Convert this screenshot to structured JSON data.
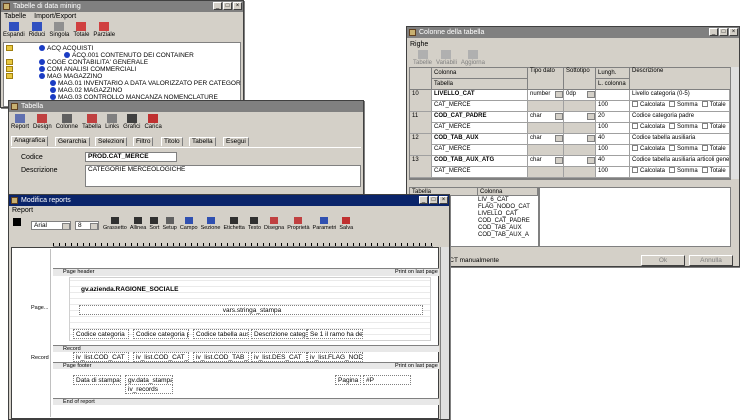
{
  "win1": {
    "title": "Tabelle di data mining",
    "menu": [
      "Tabelle",
      "Import/Export"
    ],
    "toolbar": [
      "Espandi",
      "Riduci",
      "Singola",
      "Totale",
      "Parziale"
    ],
    "tree": [
      "ACQ  ACQUISTI",
      "ACQ.001  CONTENUTO DEI CONTAINER",
      "COGE  CONTABILITA' GENERALE",
      "COM  ANALISI COMMERCIALI",
      "MAG  MAGAZZINO",
      "MAG.01  INVENTARIO A DATA VALORIZZATO PER CATEGOR",
      "MAG.02  MAGAZZINO",
      "MAG.03  CONTROLLO MANCANZA NOMENCLATURE"
    ]
  },
  "win2": {
    "title": "Tabella",
    "toolbar": [
      "Report",
      "Design",
      "Colonne",
      "Tabella",
      "Links",
      "Grafici",
      "Carica"
    ],
    "tabs": [
      "Anagrafica",
      "Gerarchia",
      "Selezioni",
      "Filtro",
      "Titolo",
      "Tabella",
      "Esegui"
    ],
    "codice_label": "Codice",
    "codice_value": "PROD.CAT_MERCE",
    "descrizione_label": "Descrizione",
    "descrizione_value": "CATEGORIE MERCEOLOGICHE"
  },
  "win3": {
    "title": "Colonne della tabella",
    "menu": [
      "Righe"
    ],
    "toolbar": [
      "Tabelle",
      "Variabili",
      "Aggiorna"
    ],
    "headers": [
      "Colonna",
      "Tabella",
      "Tipo dato",
      "Sottotipo",
      "Lungh.",
      "L. colonna",
      "Descrizione"
    ],
    "rows": [
      {
        "n": "10",
        "col": "LIVELLO_CAT",
        "tab": "CAT_MERCE",
        "tipo": "number",
        "sotto": "0dp",
        "lung": "",
        "lcol": "100",
        "desc": "Livello categoria (0-5)"
      },
      {
        "n": "11",
        "col": "COD_CAT_PADRE",
        "tab": "CAT_MERCE",
        "tipo": "char",
        "sotto": "",
        "lung": "20",
        "lcol": "100",
        "desc": "Codice categoria padre"
      },
      {
        "n": "12",
        "col": "COD_TAB_AUX",
        "tab": "CAT_MERCE",
        "tipo": "char",
        "sotto": "",
        "lung": "40",
        "lcol": "100",
        "desc": "Codice tabella ausiliaria"
      },
      {
        "n": "13",
        "col": "COD_TAB_AUX_ATG",
        "tab": "CAT_MERCE",
        "tipo": "char",
        "sotto": "",
        "lung": "40",
        "lcol": "100",
        "desc": "Codice tabella ausiliaria articoli generici"
      }
    ],
    "check_labels": [
      "Calcolata",
      "Somma",
      "Totale"
    ],
    "lower_headers": [
      "Tabella",
      "Colonna"
    ],
    "lower_list": [
      "LIV_6_CAT",
      "FLAG_NODO_CAT",
      "LIVELLO_CAT",
      "COD_CAT_PADRE",
      "COD_TAB_AUX",
      "COD_TAB_AUX_A"
    ],
    "status": "ELECT manualmente",
    "ok_label": "Ok",
    "annulla_label": "Annulla"
  },
  "win4": {
    "title": "Modifica reports",
    "menu": [
      "Report"
    ],
    "font_name": "Arial",
    "font_size": "8",
    "toolbar": [
      "Grassetto",
      "Allinea",
      "Sort",
      "Setup",
      "Campo",
      "Sezione",
      "Etichetta",
      "Testo",
      "Disegna",
      "Proprietà",
      "Parametri",
      "Salva"
    ],
    "bands": {
      "page_header": "Page header",
      "print_last": "Print on last page",
      "page_label": "Page...",
      "record": "Record",
      "record_side": "Record",
      "page_footer": "Page footer",
      "end": "End of report"
    },
    "header_fields": {
      "azienda": "gv.azienda.RAGIONE_SOCIALE",
      "stampa": "vars.stringa_stampa",
      "cols": [
        "Codice categoria",
        "Codice categoria p",
        "Codice tabella ausi",
        "Descrizione catego",
        "Se 1 il ramo ha dei"
      ]
    },
    "record_fields": [
      "iv_list.COD_CAT",
      "iv_list.COD_CAT_P",
      "iv_list.COD_TAB_A",
      "iv_list.DES_CAT",
      "iv_list.FLAG_NODC"
    ],
    "footer_fields": {
      "data_label": "Data di stampa",
      "data_value": "gv.data_stampa",
      "records": "iv_records",
      "pagina": "Pagina",
      "pagina_value": "#P"
    }
  }
}
